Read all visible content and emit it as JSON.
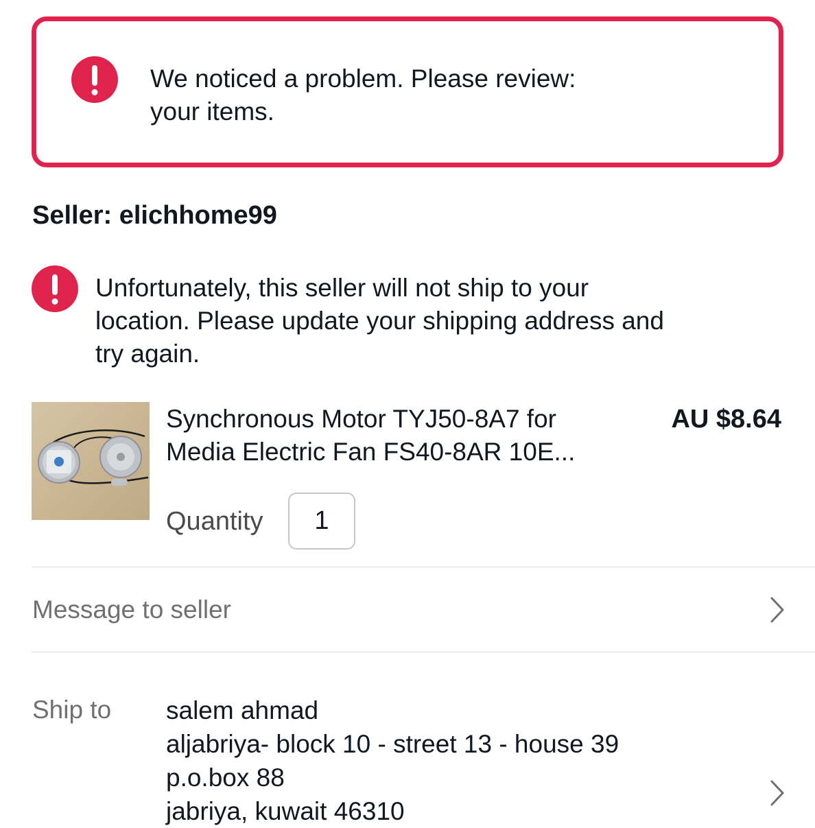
{
  "alert": {
    "icon": "exclamation-circle-icon",
    "line1": "We noticed a problem. Please review:",
    "line2": "your items."
  },
  "seller": {
    "title": "Seller: elichhome99",
    "warning_icon": "exclamation-circle-icon",
    "warning_line1": "Unfortunately, this seller will not ship to your",
    "warning_line2": "location. Please update your shipping address and",
    "warning_line3": "try again."
  },
  "item": {
    "title_line1": "Synchronous Motor TYJ50-8A7 for",
    "title_line2": "Media Electric Fan FS40-8AR 10E...",
    "price": "AU $8.64",
    "quantity_label": "Quantity",
    "quantity_value": "1",
    "thumbnail_icon": "motor-product-image"
  },
  "message_row": {
    "label": "Message to seller",
    "icon": "chevron-right-icon"
  },
  "ship_to": {
    "label": "Ship to",
    "lines": [
      "salem ahmad",
      "aljabriya- block 10 - street 13 - house 39",
      "p.o.box 88",
      "jabriya, kuwait 46310"
    ],
    "icon": "chevron-right-icon"
  },
  "colors": {
    "error": "#e0234d",
    "text": "#111820",
    "secondary_text": "#707070"
  }
}
